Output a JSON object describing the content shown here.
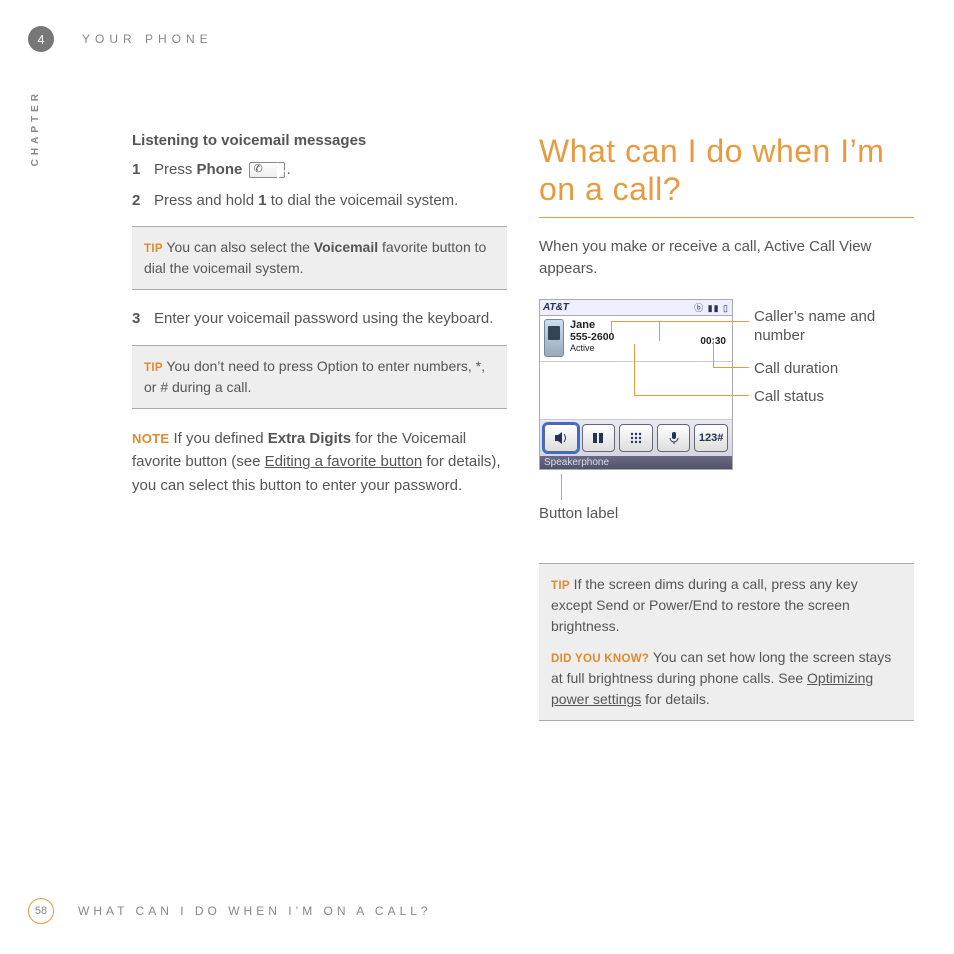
{
  "chapter_number": "4",
  "chapter_label": "CHAPTER",
  "header_title": "YOUR PHONE",
  "left": {
    "subhead": "Listening to voicemail messages",
    "steps": {
      "s1": {
        "num": "1",
        "pre": "Press ",
        "bold": "Phone",
        "post": "."
      },
      "s2": {
        "num": "2",
        "pre": "Press and hold ",
        "bold": "1",
        "post": " to dial the voicemail system."
      },
      "s3": {
        "num": "3",
        "text": "Enter your voicemail password using the keyboard."
      }
    },
    "tip1": {
      "lead": "TIP",
      "pre": "  You can also select the ",
      "bold": "Voicemail",
      "post": " favorite button to dial the voicemail system."
    },
    "tip2": {
      "lead": "TIP",
      "text": "  You don’t need to press Option to enter numbers, *, or # during a call."
    },
    "note": {
      "lead": "NOTE",
      "pre": "  If you defined ",
      "bold": "Extra Digits",
      "mid": " for the Voicemail favorite button (see ",
      "link": "Editing a favorite button",
      "post": " for details), you can select this button to enter your password."
    }
  },
  "right": {
    "heading": "What can I do when I’m on a call?",
    "intro": "When you make or receive a call, Active Call View appears.",
    "device": {
      "carrier": "AT&T",
      "name": "Jane",
      "number": "555-2600",
      "status": "Active",
      "duration": "00:30",
      "label_bar": "Speakerphone",
      "button5": "123#"
    },
    "callouts": {
      "caller": "Caller’s name and number",
      "duration": "Call duration",
      "status": "Call status",
      "button_label": "Button label"
    },
    "tip": {
      "lead": "TIP",
      "text": "  If the screen dims during a call, press any key except Send or Power/End to restore the screen brightness."
    },
    "dyk": {
      "lead": "DID YOU KNOW?",
      "pre": "  You can set how long the screen stays at full brightness during phone calls. See ",
      "link": "Optimizing power settings",
      "post": " for details."
    }
  },
  "footer": {
    "page": "58",
    "title": "WHAT CAN I DO WHEN I’M ON A CALL?"
  }
}
